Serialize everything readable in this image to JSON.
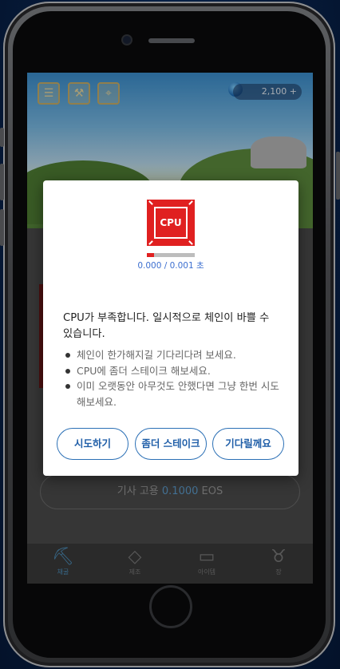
{
  "status": {
    "balance": "2,100 +"
  },
  "tabs": [
    {
      "label": "채굴",
      "icon": "mining-icon"
    },
    {
      "label": "제조",
      "icon": "diamond-icon"
    },
    {
      "label": "아이템",
      "icon": "chest-icon"
    },
    {
      "label": "장",
      "icon": "bull-icon"
    }
  ],
  "hire": {
    "prefix": "기사 고용",
    "amount": "0.1000",
    "unit": "EOS"
  },
  "dialog": {
    "icon_label": "CPU",
    "cpu_usage": "0.000 / 0.001 초",
    "cpu_progress": 0.15,
    "message": "CPU가 부족합니다. 일시적으로 체인이 바쁠 수 있습니다.",
    "tips": [
      "체인이 한가해지길 기다리다려 보세요.",
      "CPU에 좀더 스테이크 해보세요.",
      "이미 오랫동안 아무것도 안했다면 그냥 한번 시도해보세요."
    ],
    "buttons": {
      "retry": "시도하기",
      "stake": "좀더 스테이크",
      "wait": "기다릴께요"
    }
  },
  "colors": {
    "accent_red": "#e02020",
    "button_blue": "#1f5ea8",
    "usage_blue": "#3c6fd0"
  }
}
